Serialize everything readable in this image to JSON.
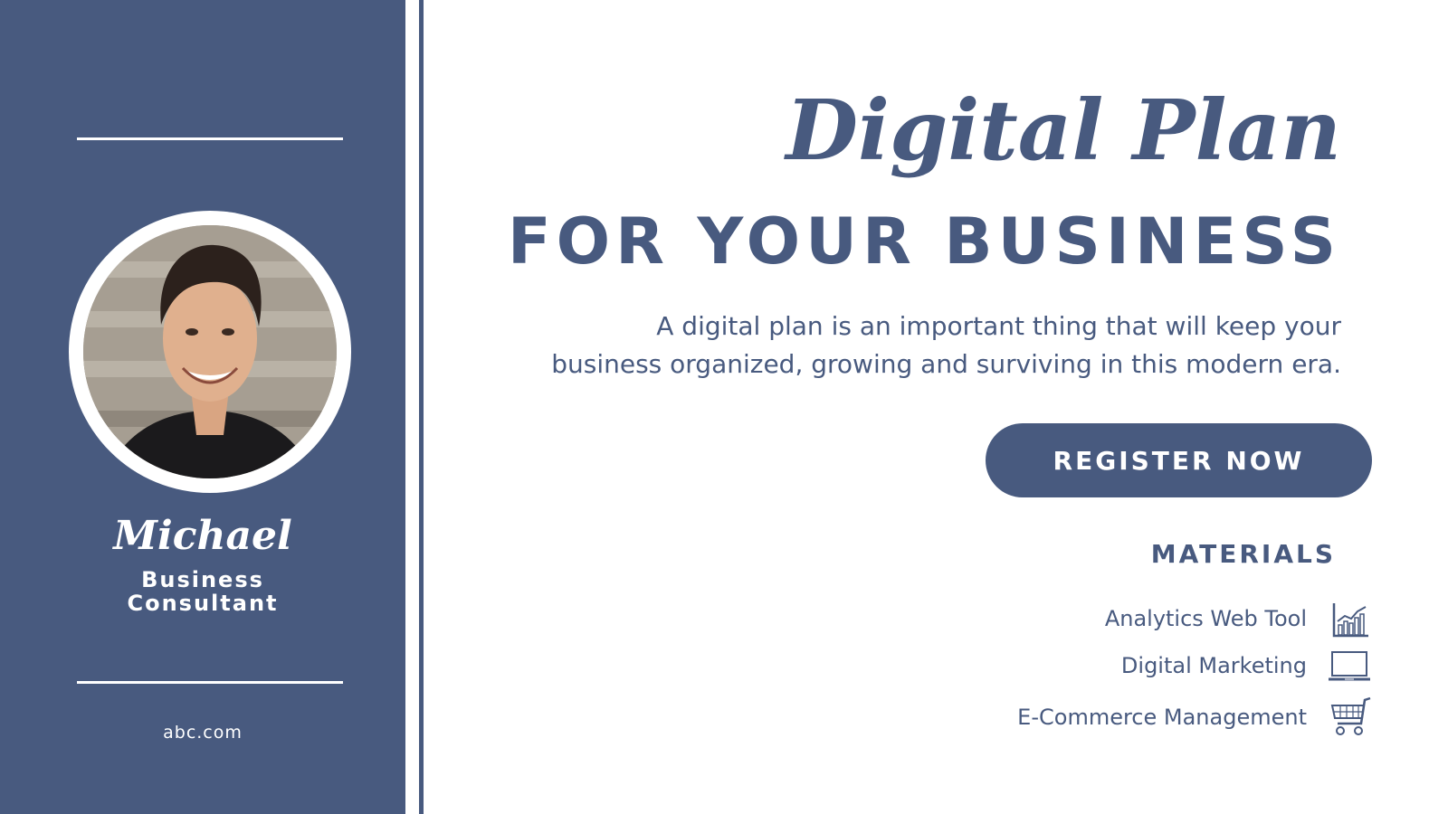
{
  "sidebar": {
    "profile": {
      "name": "Michael",
      "role_line1": "Business",
      "role_line2": "Consultant"
    },
    "website": "abc.com"
  },
  "main": {
    "title_script": "Digital Plan",
    "title_caps": "FOR YOUR BUSINESS",
    "description_line1": "A digital plan is an important thing that will keep your",
    "description_line2": "business organized, growing and surviving in this modern era.",
    "register_label": "REGISTER NOW",
    "materials": {
      "heading": "MATERIALS",
      "items": [
        {
          "label": "Analytics Web Tool",
          "icon": "bar-chart-icon"
        },
        {
          "label": "Digital Marketing",
          "icon": "laptop-icon"
        },
        {
          "label": "E-Commerce Management",
          "icon": "shopping-cart-icon"
        }
      ]
    }
  },
  "colors": {
    "brand": "#485a7f",
    "background": "#ffffff"
  }
}
